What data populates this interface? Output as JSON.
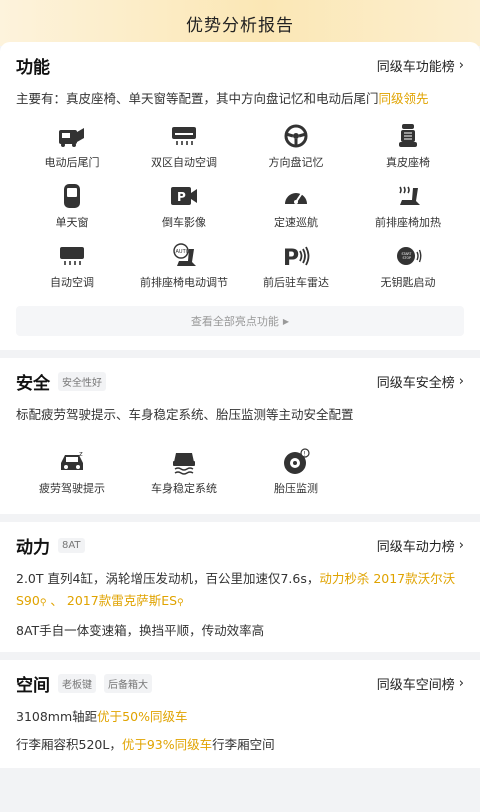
{
  "header": {
    "title": "优势分析报告"
  },
  "function": {
    "title": "功能",
    "rank_label": "同级车功能榜",
    "desc_prefix": "主要有：真皮座椅、单天窗等配置，其中方向盘记忆和电动后尾门",
    "desc_highlight": "同级领先",
    "features": [
      {
        "label": "电动后尾门",
        "icon": "tailgate-icon"
      },
      {
        "label": "双区自动空调",
        "icon": "climate-icon"
      },
      {
        "label": "方向盘记忆",
        "icon": "steering-wheel-icon"
      },
      {
        "label": "真皮座椅",
        "icon": "leather-seat-icon"
      },
      {
        "label": "单天窗",
        "icon": "sunroof-icon"
      },
      {
        "label": "倒车影像",
        "icon": "reverse-camera-icon"
      },
      {
        "label": "定速巡航",
        "icon": "cruise-control-icon"
      },
      {
        "label": "前排座椅加热",
        "icon": "seat-heating-icon"
      },
      {
        "label": "自动空调",
        "icon": "auto-ac-icon"
      },
      {
        "label": "前排座椅电动调节",
        "icon": "power-seat-icon"
      },
      {
        "label": "前后驻车雷达",
        "icon": "parking-radar-icon"
      },
      {
        "label": "无钥匙启动",
        "icon": "keyless-start-icon"
      }
    ],
    "more_label": "查看全部亮点功能"
  },
  "safety": {
    "title": "安全",
    "tag": "安全性好",
    "rank_label": "同级车安全榜",
    "desc": "标配疲劳驾驶提示、车身稳定系统、胎压监测等主动安全配置",
    "features": [
      {
        "label": "疲劳驾驶提示",
        "icon": "fatigue-alert-icon"
      },
      {
        "label": "车身稳定系统",
        "icon": "stability-control-icon"
      },
      {
        "label": "胎压监测",
        "icon": "tire-pressure-icon"
      }
    ]
  },
  "power": {
    "title": "动力",
    "tag": "8AT",
    "rank_label": "同级车动力榜",
    "line1_prefix": "2.0T 直列4缸，涡轮增压发动机，百公里加速仅7.6s，",
    "line1_highlight": "动力秒杀 2017款沃尔沃S90",
    "line1_sep": " 、 ",
    "line1_highlight2": "2017款雷克萨斯ES",
    "line2": "8AT手自一体变速箱，换挡平顺，传动效率高"
  },
  "space": {
    "title": "空间",
    "tags": [
      "老板键",
      "后备箱大"
    ],
    "rank_label": "同级车空间榜",
    "line1_prefix": "3108mm轴距",
    "line1_highlight": "优于50%同级车",
    "line2_prefix": "行李厢容积520L，",
    "line2_highlight": "优于93%同级车",
    "line2_suffix": "行李厢空间"
  },
  "colors": {
    "accent": "#e0a300",
    "header_bg": "#fbe7b5"
  }
}
